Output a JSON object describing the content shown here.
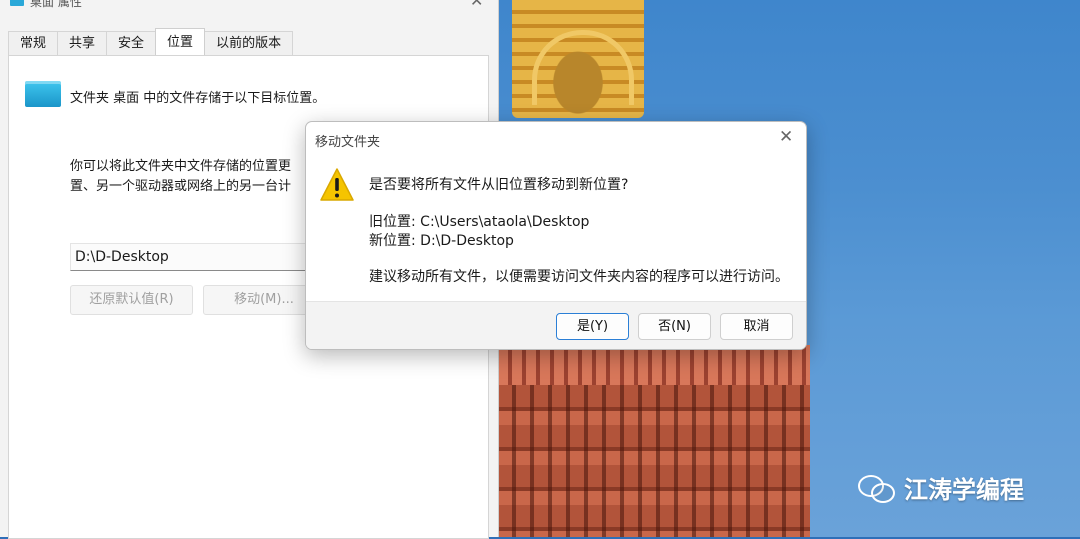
{
  "properties_window": {
    "title": "桌面 属性",
    "tabs": [
      {
        "label": "常规"
      },
      {
        "label": "共享"
      },
      {
        "label": "安全"
      },
      {
        "label": "位置",
        "active": true
      },
      {
        "label": "以前的版本"
      }
    ],
    "location_tab": {
      "description": "文件夹 桌面 中的文件存储于以下目标位置。",
      "para_line1": "你可以将此文件夹中文件存储的位置更",
      "para_line2": "置、另一个驱动器或网络上的另一台计",
      "path_value": "D:\\D-Desktop",
      "restore_default_label": "还原默认值(R)",
      "move_label": "移动(M)..."
    }
  },
  "move_dialog": {
    "title": "移动文件夹",
    "question": "是否要将所有文件从旧位置移动到新位置?",
    "old_location": "旧位置: C:\\Users\\ataola\\Desktop",
    "new_location": "新位置: D:\\D-Desktop",
    "note": "建议移动所有文件，以便需要访问文件夹内容的程序可以进行访问。",
    "buttons": {
      "yes": "是(Y)",
      "no": "否(N)",
      "cancel": "取消"
    },
    "icon": "warning-icon"
  },
  "watermark": {
    "text": "江涛学编程",
    "icon": "wechat-icon"
  },
  "colors": {
    "accent": "#2b7fd6",
    "folder": "#2aa8d8",
    "warning": "#f5c400"
  }
}
